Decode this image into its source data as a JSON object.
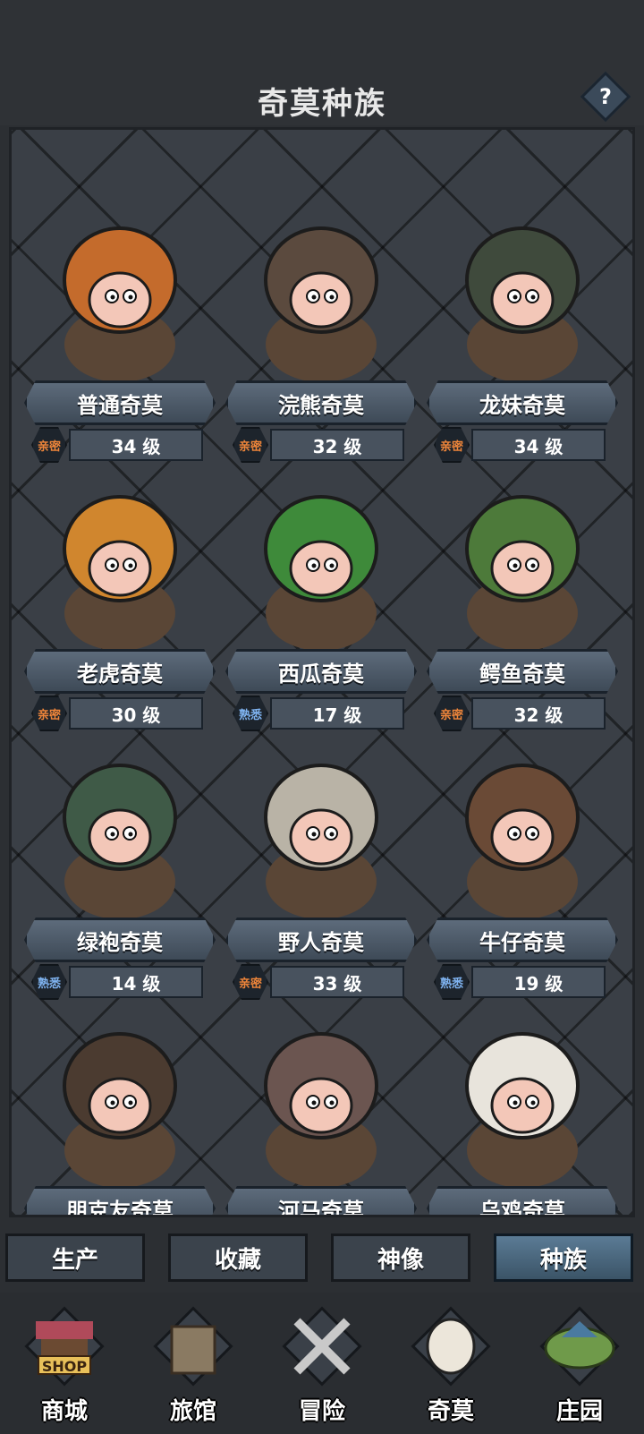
{
  "header": {
    "title": "奇莫种族",
    "help_icon": "?"
  },
  "races": [
    {
      "name": "普通奇莫",
      "bond": "亲密",
      "bond_type": "close",
      "level": "34 级",
      "icon": "pumpkin-hood-icon",
      "color": "#c46b2c"
    },
    {
      "name": "浣熊奇莫",
      "bond": "亲密",
      "bond_type": "close",
      "level": "32 级",
      "icon": "raccoon-hood-icon",
      "color": "#5b4a3e"
    },
    {
      "name": "龙妹奇莫",
      "bond": "亲密",
      "bond_type": "close",
      "level": "34 级",
      "icon": "dragon-hood-icon",
      "color": "#3f4a3c"
    },
    {
      "name": "老虎奇莫",
      "bond": "亲密",
      "bond_type": "close",
      "level": "30 级",
      "icon": "tiger-hood-icon",
      "color": "#d0862e"
    },
    {
      "name": "西瓜奇莫",
      "bond": "熟悉",
      "bond_type": "familiar",
      "level": "17 级",
      "icon": "watermelon-helmet-icon",
      "color": "#3e8a3a"
    },
    {
      "name": "鳄鱼奇莫",
      "bond": "亲密",
      "bond_type": "close",
      "level": "32 级",
      "icon": "crocodile-hood-icon",
      "color": "#4d7a3a"
    },
    {
      "name": "绿袍奇莫",
      "bond": "熟悉",
      "bond_type": "familiar",
      "level": "14 级",
      "icon": "green-robe-hood-icon",
      "color": "#3f5a47"
    },
    {
      "name": "野人奇莫",
      "bond": "亲密",
      "bond_type": "close",
      "level": "33 级",
      "icon": "skull-helmet-icon",
      "color": "#b9b3a6"
    },
    {
      "name": "牛仔奇莫",
      "bond": "熟悉",
      "bond_type": "familiar",
      "level": "19 级",
      "icon": "cowboy-hat-icon",
      "color": "#6a4a36"
    },
    {
      "name": "朋克友奇莫",
      "bond": "",
      "bond_type": "none",
      "level": "",
      "icon": "punk-goggles-icon",
      "color": "#4b3b30"
    },
    {
      "name": "河马奇莫",
      "bond": "",
      "bond_type": "none",
      "level": "",
      "icon": "hippo-hood-icon",
      "color": "#6b5550"
    },
    {
      "name": "乌鸡奇莫",
      "bond": "",
      "bond_type": "none",
      "level": "",
      "icon": "silkie-chicken-hood-icon",
      "color": "#e8e4dc"
    }
  ],
  "tabs": [
    {
      "label": "生产",
      "active": false
    },
    {
      "label": "收藏",
      "active": false
    },
    {
      "label": "神像",
      "active": false
    },
    {
      "label": "种族",
      "active": true
    }
  ],
  "nav": [
    {
      "label": "商城",
      "sign": "SHOP",
      "icon": "shop-stall-icon"
    },
    {
      "label": "旅馆",
      "icon": "inn-gate-icon"
    },
    {
      "label": "冒险",
      "icon": "crossed-swords-icon"
    },
    {
      "label": "奇莫",
      "icon": "chicken-kimo-icon"
    },
    {
      "label": "庄园",
      "icon": "floating-island-icon"
    }
  ]
}
